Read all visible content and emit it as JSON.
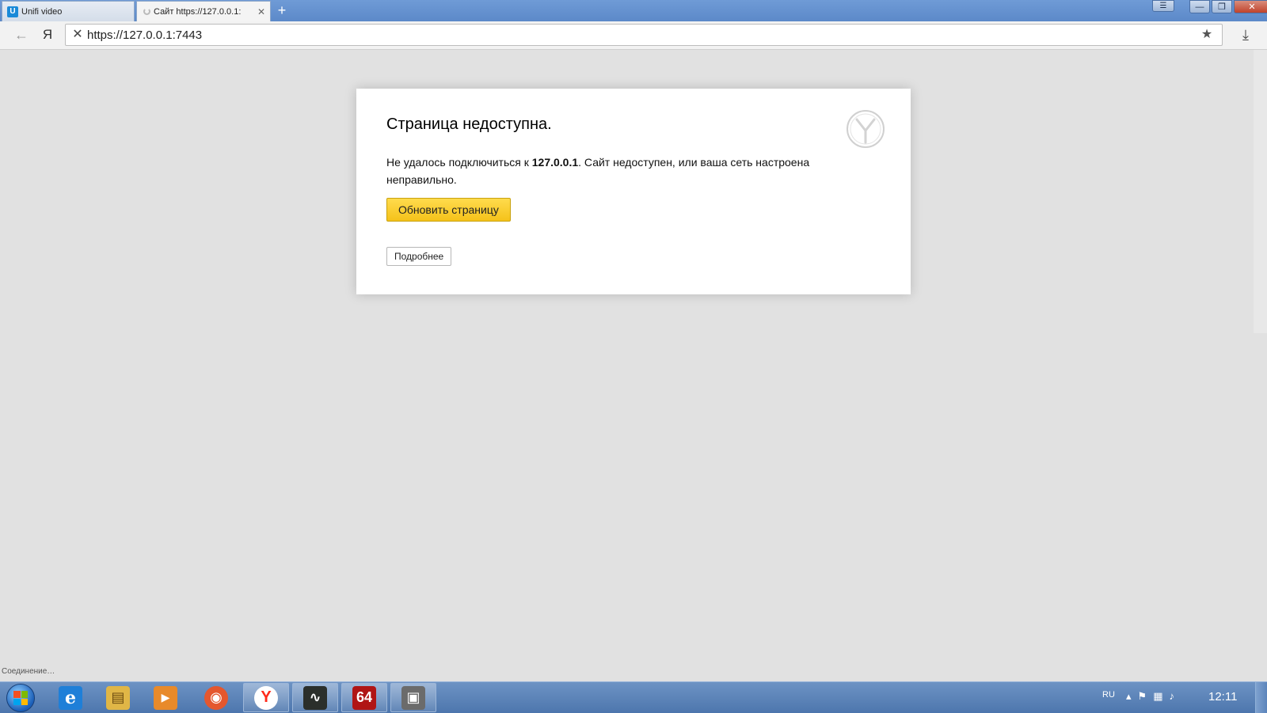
{
  "browser": {
    "tabs": [
      {
        "icon": "unifi-icon",
        "icon_glyph": "U",
        "title": "Unifi video"
      },
      {
        "icon": "loading-spinner-icon",
        "title": "Сайт https://127.0.0.1:",
        "close": "✕"
      }
    ],
    "new_tab_glyph": "+",
    "address": {
      "url": "https://127.0.0.1:7443",
      "back_glyph": "←",
      "yandex_glyph": "Я",
      "stop_glyph": "✕",
      "bookmark_glyph": "★",
      "download_glyph": "⤓"
    },
    "window_controls": {
      "menu": "☰",
      "minimize": "—",
      "restore": "❐",
      "close": "✕"
    }
  },
  "error_page": {
    "title": "Страница недоступна.",
    "message_prefix": "Не удалось подключиться к ",
    "message_host": "127.0.0.1",
    "message_suffix": ". Сайт недоступен, или ваша сеть настроена неправильно.",
    "reload_button": "Обновить страницу",
    "details_button": "Подробнее",
    "logo": "yandex-browser-logo-icon"
  },
  "status_bar": {
    "text": "Соединение…"
  },
  "taskbar": {
    "items": [
      {
        "name": "internet-explorer",
        "glyph": "e",
        "color": "#1e7fd8"
      },
      {
        "name": "file-explorer",
        "glyph": "▤",
        "color": "#e0b646"
      },
      {
        "name": "media-player",
        "glyph": "▶",
        "color": "#e88a2a"
      },
      {
        "name": "firefox",
        "glyph": "◉",
        "color": "#e4572e"
      },
      {
        "name": "yandex-browser",
        "glyph": "Y",
        "color": "#ff2a1a"
      },
      {
        "name": "ubiquiti-tool",
        "glyph": "∿",
        "color": "#2b2f2b"
      },
      {
        "name": "aida64",
        "glyph": "64",
        "color": "#b01515"
      },
      {
        "name": "archive-tool",
        "glyph": "▣",
        "color": "#6b6b6b"
      }
    ],
    "tray": {
      "language": "RU",
      "clock": "12:11"
    }
  }
}
